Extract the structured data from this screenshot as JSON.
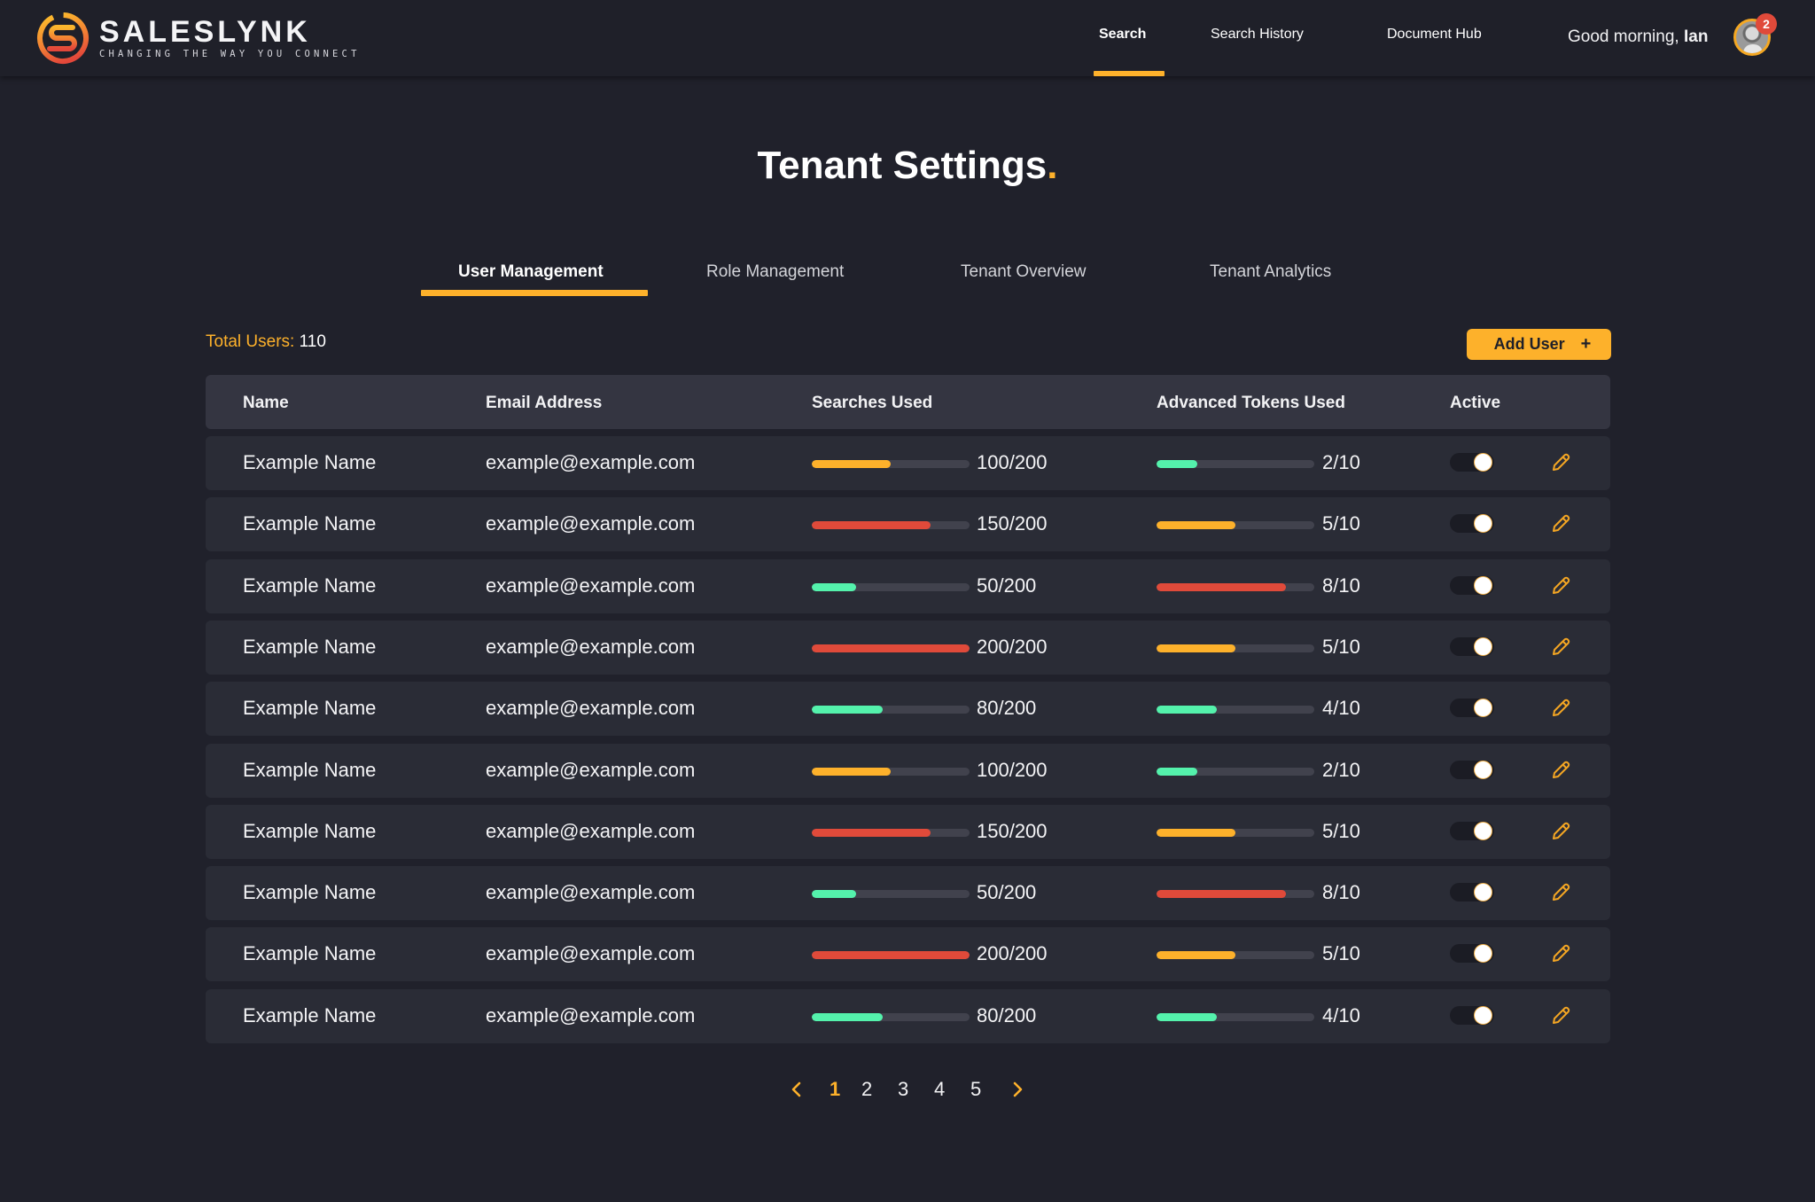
{
  "brand": {
    "name": "SALESLYNK",
    "tagline": "CHANGING THE WAY YOU CONNECT"
  },
  "nav": {
    "items": [
      {
        "label": "Search",
        "active": true
      },
      {
        "label": "Search History",
        "active": false
      },
      {
        "label": "Document Hub",
        "active": false
      }
    ],
    "greeting_prefix": "Good morning, ",
    "user_name": "Ian",
    "notification_count": "2"
  },
  "page": {
    "title": "Tenant Settings",
    "title_dot": "."
  },
  "tabs": [
    {
      "label": "User Management",
      "active": true
    },
    {
      "label": "Role Management",
      "active": false
    },
    {
      "label": "Tenant Overview",
      "active": false
    },
    {
      "label": "Tenant Analytics",
      "active": false
    }
  ],
  "summary": {
    "total_label": "Total Users: ",
    "total_value": "110"
  },
  "toolbar": {
    "add_user_label": "Add User",
    "add_user_icon": "+"
  },
  "table": {
    "columns": [
      "Name",
      "Email Address",
      "Searches Used",
      "Advanced Tokens Used",
      "Active"
    ],
    "rows": [
      {
        "name": "Example Name",
        "email": "example@example.com",
        "searches": "100/200",
        "searches_fill": 0.5,
        "searches_status": "warning",
        "tokens": "2/10",
        "tokens_fill": 0.26,
        "tokens_status": "ok",
        "active": true
      },
      {
        "name": "Example Name",
        "email": "example@example.com",
        "searches": "150/200",
        "searches_fill": 0.75,
        "searches_status": "critical",
        "tokens": "5/10",
        "tokens_fill": 0.5,
        "tokens_status": "warning",
        "active": true
      },
      {
        "name": "Example Name",
        "email": "example@example.com",
        "searches": "50/200",
        "searches_fill": 0.28,
        "searches_status": "ok",
        "tokens": "8/10",
        "tokens_fill": 0.82,
        "tokens_status": "critical",
        "active": true
      },
      {
        "name": "Example Name",
        "email": "example@example.com",
        "searches": "200/200",
        "searches_fill": 1.0,
        "searches_status": "critical",
        "tokens": "5/10",
        "tokens_fill": 0.5,
        "tokens_status": "warning",
        "active": true
      },
      {
        "name": "Example Name",
        "email": "example@example.com",
        "searches": "80/200",
        "searches_fill": 0.45,
        "searches_status": "ok",
        "tokens": "4/10",
        "tokens_fill": 0.38,
        "tokens_status": "ok",
        "active": true
      },
      {
        "name": "Example Name",
        "email": "example@example.com",
        "searches": "100/200",
        "searches_fill": 0.5,
        "searches_status": "warning",
        "tokens": "2/10",
        "tokens_fill": 0.26,
        "tokens_status": "ok",
        "active": true
      },
      {
        "name": "Example Name",
        "email": "example@example.com",
        "searches": "150/200",
        "searches_fill": 0.75,
        "searches_status": "critical",
        "tokens": "5/10",
        "tokens_fill": 0.5,
        "tokens_status": "warning",
        "active": true
      },
      {
        "name": "Example Name",
        "email": "example@example.com",
        "searches": "50/200",
        "searches_fill": 0.28,
        "searches_status": "ok",
        "tokens": "8/10",
        "tokens_fill": 0.82,
        "tokens_status": "critical",
        "active": true
      },
      {
        "name": "Example Name",
        "email": "example@example.com",
        "searches": "200/200",
        "searches_fill": 1.0,
        "searches_status": "critical",
        "tokens": "5/10",
        "tokens_fill": 0.5,
        "tokens_status": "warning",
        "active": true
      },
      {
        "name": "Example Name",
        "email": "example@example.com",
        "searches": "80/200",
        "searches_fill": 0.45,
        "searches_status": "ok",
        "tokens": "4/10",
        "tokens_fill": 0.38,
        "tokens_status": "ok",
        "active": true
      }
    ]
  },
  "pagination": {
    "pages": [
      "1",
      "2",
      "3",
      "4",
      "5"
    ],
    "current": "1"
  },
  "colors": {
    "accent": "#fdb12b",
    "ok": "#54f2ac",
    "warning": "#fdb12b",
    "critical": "#e04a3a",
    "background": "#20212b",
    "row": "#2a2c36",
    "header_row": "#343541"
  },
  "icons": {
    "logo": "saleslynk-s-logo",
    "edit": "pencil-icon",
    "prev": "chevron-left-icon",
    "next": "chevron-right-icon",
    "add": "plus-icon"
  }
}
